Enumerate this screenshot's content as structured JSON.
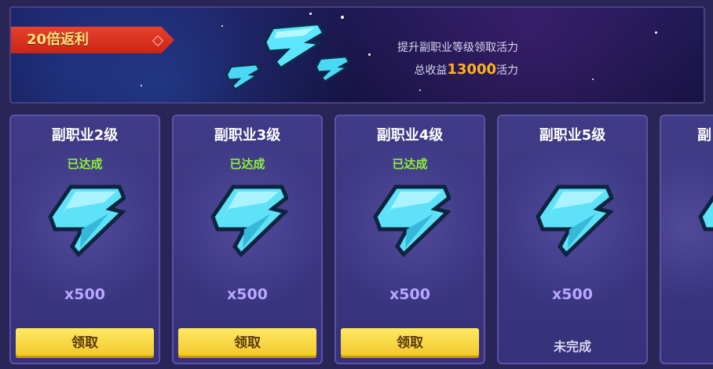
{
  "banner": {
    "ribbon_label": "20倍返利",
    "desc": "提升副职业等级领取活力",
    "total_prefix": "总收益",
    "total_value": "13000",
    "total_suffix": "活力"
  },
  "cards": [
    {
      "title": "副职业2级",
      "status": "已达成",
      "qty": "x500",
      "button": "领取"
    },
    {
      "title": "副职业3级",
      "status": "已达成",
      "qty": "x500",
      "button": "领取"
    },
    {
      "title": "副职业4级",
      "status": "已达成",
      "qty": "x500",
      "button": "领取"
    },
    {
      "title": "副职业5级",
      "status": "",
      "qty": "x500",
      "pending": "未完成"
    },
    {
      "title": "副"
    }
  ],
  "icons": {
    "reward": "cyan-energy-gem-icon"
  },
  "colors": {
    "accent": "#ffb21a",
    "button": "#f1c62a",
    "achieved": "#8ff03a",
    "ribbon": "#e8412c"
  }
}
